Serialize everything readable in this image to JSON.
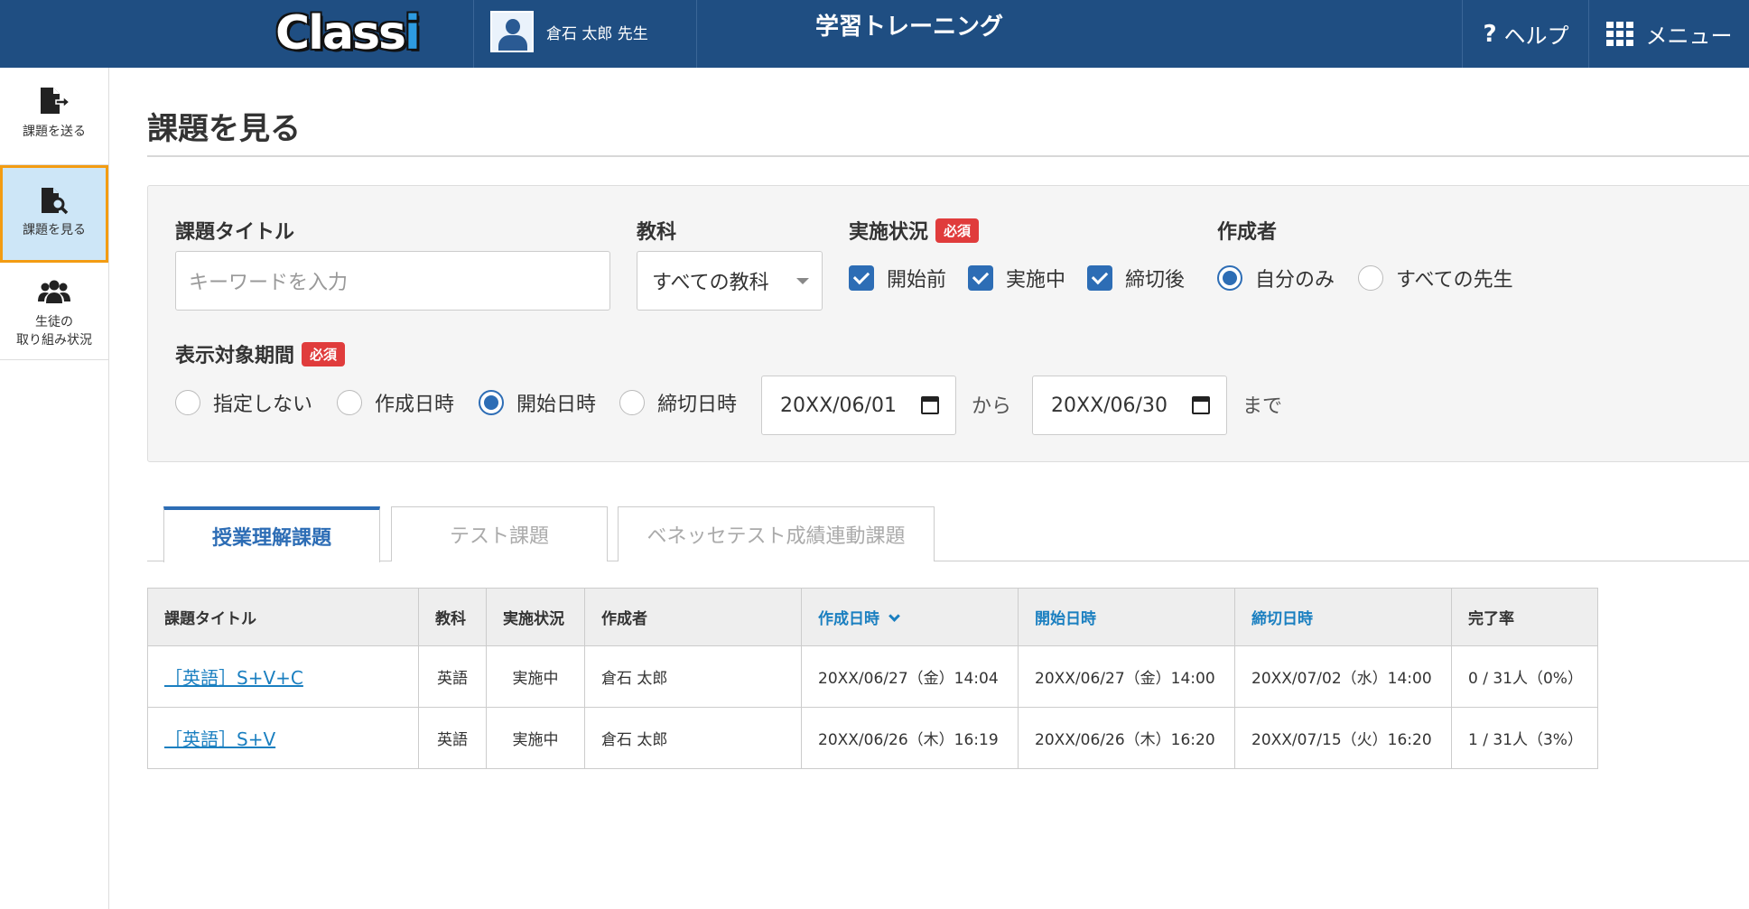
{
  "header": {
    "logo_main": "Class",
    "logo_i": "i",
    "user_name": "倉石 太郎 先生",
    "app_title": "学習トレーニング",
    "help_label": "ヘルプ",
    "menu_label": "メニュー"
  },
  "sidebar": {
    "items": [
      {
        "label": "課題を送る",
        "icon": "file-send-icon"
      },
      {
        "label": "課題を見る",
        "icon": "file-search-icon"
      },
      {
        "label": "生徒の",
        "label2": "取り組み状況",
        "icon": "users-icon"
      }
    ]
  },
  "page": {
    "title": "課題を見る"
  },
  "filters": {
    "title_label": "課題タイトル",
    "title_placeholder": "キーワードを入力",
    "subject_label": "教科",
    "subject_value": "すべての教科",
    "status_label": "実施状況",
    "required": "必須",
    "status_options": [
      "開始前",
      "実施中",
      "締切後"
    ],
    "author_label": "作成者",
    "author_options": [
      "自分のみ",
      "すべての先生"
    ],
    "author_selected": "自分のみ",
    "period_label": "表示対象期間",
    "period_options": [
      "指定しない",
      "作成日時",
      "開始日時",
      "締切日時"
    ],
    "period_selected": "開始日時",
    "date_from": "20XX/06/01",
    "from_text": "から",
    "date_to": "20XX/06/30",
    "to_text": "まで"
  },
  "tabs": [
    {
      "label": "授業理解課題",
      "active": true
    },
    {
      "label": "テスト課題",
      "active": false
    },
    {
      "label": "ベネッセテスト成績連動課題",
      "active": false
    }
  ],
  "table": {
    "headers": [
      "課題タイトル",
      "教科",
      "実施状況",
      "作成者",
      "作成日時",
      "開始日時",
      "締切日時",
      "完了率"
    ],
    "rows": [
      {
        "title": "［英語］S+V+C",
        "subject": "英語",
        "status": "実施中",
        "author": "倉石 太郎",
        "created": "20XX/06/27（金）14:04",
        "start": "20XX/06/27（金）14:00",
        "deadline": "20XX/07/02（水）14:00",
        "rate": "0 / 31人（0%）"
      },
      {
        "title": "［英語］S+V",
        "subject": "英語",
        "status": "実施中",
        "author": "倉石 太郎",
        "created": "20XX/06/26（木）16:19",
        "start": "20XX/06/26（木）16:20",
        "deadline": "20XX/07/15（火）16:20",
        "rate": "1 / 31人（3%）"
      }
    ]
  },
  "colors": {
    "header_bg": "#1f4e82",
    "accent": "#2d6db5",
    "required_badge": "#e03c3c",
    "active_sidebar_border": "#f39c12"
  }
}
